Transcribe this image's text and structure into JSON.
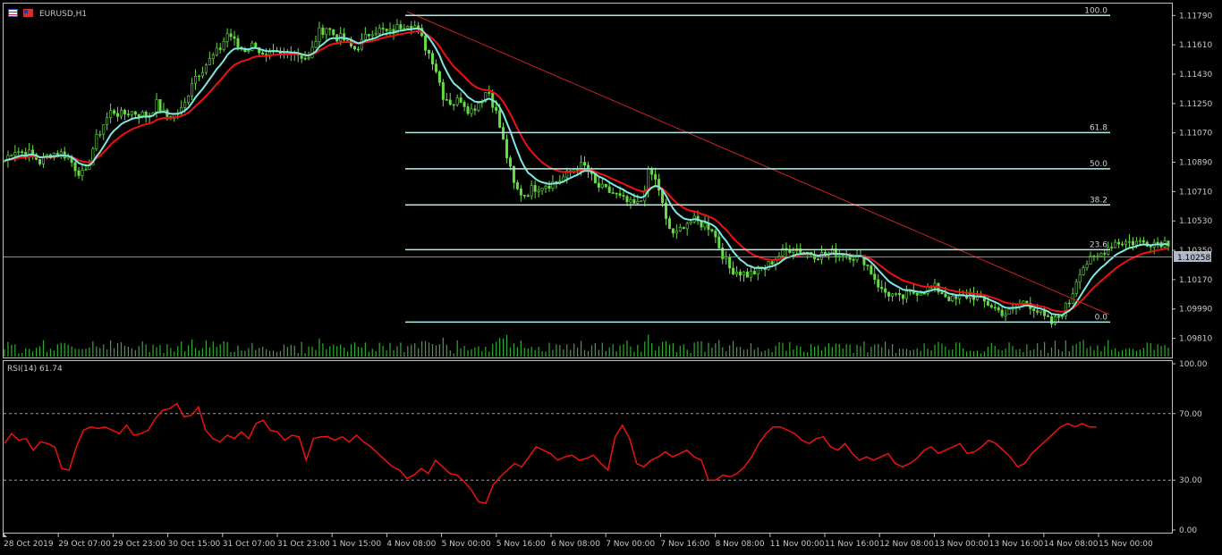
{
  "window": {
    "symbol_label": "EURUSD,H1",
    "current_price": "1.10258"
  },
  "colors": {
    "background": "#000000",
    "frame": "#c0c0c0",
    "candle": "#66dd44",
    "ma_fast": "#7fe8e0",
    "ma_slow": "#ee1111",
    "fib": "#b8ecec",
    "trend": "#cc2222",
    "rsi": "#ee1111",
    "volume": "#33aa33"
  },
  "chart_data": [
    {
      "type": "candlestick",
      "title": "EURUSD,H1",
      "price_axis_ticks": [
        "1.11790",
        "1.11610",
        "1.11430",
        "1.11250",
        "1.11070",
        "1.10890",
        "1.10710",
        "1.10530",
        "1.10350",
        "1.10170",
        "1.09990",
        "1.09810"
      ],
      "ylim": [
        1.0972,
        1.1183
      ],
      "current_price": 1.10258,
      "time_axis_ticks": [
        "28 Oct 2019",
        "29 Oct 07:00",
        "29 Oct 23:00",
        "30 Oct 15:00",
        "31 Oct 07:00",
        "31 Oct 23:00",
        "1 Nov 15:00",
        "4 Nov 08:00",
        "5 Nov 00:00",
        "5 Nov 16:00",
        "6 Nov 08:00",
        "7 Nov 00:00",
        "7 Nov 16:00",
        "8 Nov 08:00",
        "11 Nov 00:00",
        "11 Nov 16:00",
        "12 Nov 08:00",
        "13 Nov 00:00",
        "13 Nov 16:00",
        "14 Nov 08:00",
        "15 Nov 00:00"
      ],
      "close_anchors": {
        "index": [
          0,
          10,
          20,
          30,
          40,
          50,
          60,
          70,
          80,
          90,
          100,
          110,
          120,
          130,
          140,
          150,
          160,
          170,
          180,
          190,
          200,
          210,
          220,
          230,
          240,
          250,
          260,
          270,
          280,
          290,
          300,
          310,
          320,
          330,
          340,
          350,
          360,
          370,
          380,
          390,
          400,
          410,
          420,
          430,
          440,
          450,
          460,
          470,
          480,
          490,
          500,
          510,
          520,
          530,
          540,
          550,
          560,
          570,
          580,
          590,
          600,
          610,
          620,
          630,
          640,
          650,
          660,
          670,
          680,
          690,
          700,
          710,
          720,
          730,
          740,
          750,
          760,
          770,
          780,
          790,
          800,
          810,
          820,
          830,
          840,
          850,
          860,
          870,
          880,
          890,
          900,
          910,
          920,
          930,
          940,
          950,
          960,
          970,
          980,
          990,
          1000,
          1010,
          1020,
          1030,
          1040,
          1050,
          1060,
          1070,
          1080,
          1090,
          1100,
          1110,
          1120,
          1130,
          1140,
          1150,
          1160,
          1170,
          1180,
          1190,
          1200,
          1210,
          1220,
          1230,
          1240,
          1250,
          1260,
          1270,
          1280,
          1290,
          1300
        ],
        "value": [
          1.109,
          1.1097,
          1.1095,
          1.1094,
          1.1089,
          1.1094,
          1.1095,
          1.1093,
          1.1085,
          1.108,
          1.11,
          1.1112,
          1.1121,
          1.1118,
          1.112,
          1.1119,
          1.1117,
          1.1125,
          1.1117,
          1.1118,
          1.1122,
          1.114,
          1.1146,
          1.1152,
          1.1158,
          1.1169,
          1.116,
          1.1158,
          1.1162,
          1.1152,
          1.1155,
          1.1154,
          1.1158,
          1.1155,
          1.1152,
          1.1168,
          1.1172,
          1.1166,
          1.1164,
          1.1158,
          1.1163,
          1.117,
          1.117,
          1.1168,
          1.1172,
          1.1175,
          1.1172,
          1.116,
          1.115,
          1.113,
          1.1125,
          1.1128,
          1.112,
          1.1126,
          1.1134,
          1.1118,
          1.1095,
          1.1073,
          1.1069,
          1.1073,
          1.1075,
          1.1076,
          1.1078,
          1.1082,
          1.1087,
          1.1086,
          1.1075,
          1.1072,
          1.107,
          1.1066,
          1.1063,
          1.1063,
          1.1084,
          1.1075,
          1.105,
          1.1044,
          1.1052,
          1.1053,
          1.1051,
          1.1049,
          1.1035,
          1.1024,
          1.1022,
          1.102,
          1.1022,
          1.1024,
          1.103,
          1.1034,
          1.1037,
          1.1035,
          1.1033,
          1.1032,
          1.1033,
          1.1034,
          1.1033,
          1.1031,
          1.1029,
          1.102,
          1.101,
          1.1008,
          1.1005,
          1.1008,
          1.101,
          1.1011,
          1.1012,
          1.1008,
          1.1004,
          1.1006,
          1.1008,
          1.1004,
          1.1002,
          1.0998,
          1.0996,
          1.1,
          1.1004,
          1.1,
          1.0994,
          1.099,
          1.0996,
          1.1004,
          1.1022,
          1.1028,
          1.103,
          1.1036,
          1.104,
          1.104,
          1.104,
          1.104,
          1.104,
          1.104,
          1.104
        ]
      }
    },
    {
      "type": "bar",
      "title": "Volume",
      "series_shape": "tick volume histogram"
    },
    {
      "type": "line",
      "title": "RSI(14) 61.74",
      "indicator_label": "RSI(14) 61.74",
      "axis_ticks": [
        "100.00",
        "70.00",
        "30.00",
        "0.00"
      ],
      "ylim": [
        0,
        100
      ],
      "levels": [
        70,
        30
      ],
      "last_value": 61.74,
      "points": {
        "x": [
          0,
          8,
          16,
          24,
          32,
          40,
          48,
          56,
          64,
          72,
          80,
          88,
          96,
          104,
          112,
          120,
          128,
          136,
          144,
          152,
          160,
          168,
          176,
          184,
          192,
          200,
          208,
          216,
          224,
          232,
          240,
          248,
          256,
          264,
          272,
          280,
          288,
          296,
          304,
          312,
          320,
          328,
          336,
          344,
          352,
          360,
          368,
          376,
          384,
          392,
          400,
          408,
          416,
          424,
          432,
          440,
          448,
          456,
          464,
          472,
          480,
          488,
          496,
          504,
          512,
          520,
          528,
          536,
          544,
          552,
          560,
          568,
          576,
          584,
          592,
          600,
          608,
          616,
          624,
          632,
          640,
          648,
          656,
          664,
          672,
          680,
          688,
          696,
          704,
          712,
          720,
          728,
          736,
          744,
          752,
          760,
          768,
          776,
          784,
          792,
          800,
          808,
          816,
          824,
          832,
          840,
          848,
          856,
          864,
          872,
          880,
          888,
          896,
          904,
          912,
          920,
          928,
          936,
          944,
          952,
          960,
          968,
          976,
          984,
          992,
          1000,
          1008,
          1016,
          1024,
          1032,
          1040,
          1048,
          1056,
          1064,
          1072,
          1080,
          1088,
          1096,
          1104,
          1112,
          1120,
          1128,
          1136,
          1144,
          1152,
          1160,
          1168,
          1176,
          1184,
          1192,
          1200,
          1208,
          1216,
          1224,
          1232,
          1240,
          1248,
          1256,
          1264,
          1272,
          1280,
          1288,
          1296
        ],
        "y": [
          52,
          58,
          54,
          55,
          48,
          53,
          52,
          50,
          37,
          36,
          50,
          60,
          62,
          61,
          62,
          60,
          58,
          63,
          57,
          58,
          60,
          67,
          72,
          73,
          76,
          68,
          69,
          74,
          60,
          55,
          53,
          57,
          55,
          59,
          55,
          64,
          66,
          60,
          59,
          54,
          57,
          56,
          42,
          55,
          56,
          56,
          54,
          56,
          53,
          57,
          53,
          50,
          46,
          42,
          38,
          36,
          31,
          33,
          37,
          34,
          42,
          38,
          34,
          33,
          29,
          24,
          17,
          16,
          27,
          32,
          36,
          40,
          38,
          44,
          50,
          48,
          46,
          42,
          44,
          45,
          42,
          43,
          45,
          40,
          36,
          56,
          63,
          55,
          40,
          38,
          42,
          44,
          47,
          44,
          46,
          48,
          44,
          42,
          30,
          30,
          33,
          32,
          34,
          38,
          44,
          52,
          58,
          62,
          62,
          60,
          58,
          54,
          52,
          55,
          56,
          50,
          48,
          52,
          46,
          42,
          44,
          42,
          44,
          46,
          40,
          38,
          40,
          43,
          48,
          50,
          46,
          48,
          50,
          52,
          46,
          47,
          50,
          54,
          52,
          48,
          44,
          38,
          40,
          46,
          50,
          54,
          58,
          62,
          64,
          62,
          64,
          62,
          62
        ]
      }
    },
    {
      "type": "fibonacci_retracement",
      "levels": [
        "100.0",
        "61.8",
        "50.0",
        "38.2",
        "23.6",
        "0.0"
      ]
    }
  ]
}
